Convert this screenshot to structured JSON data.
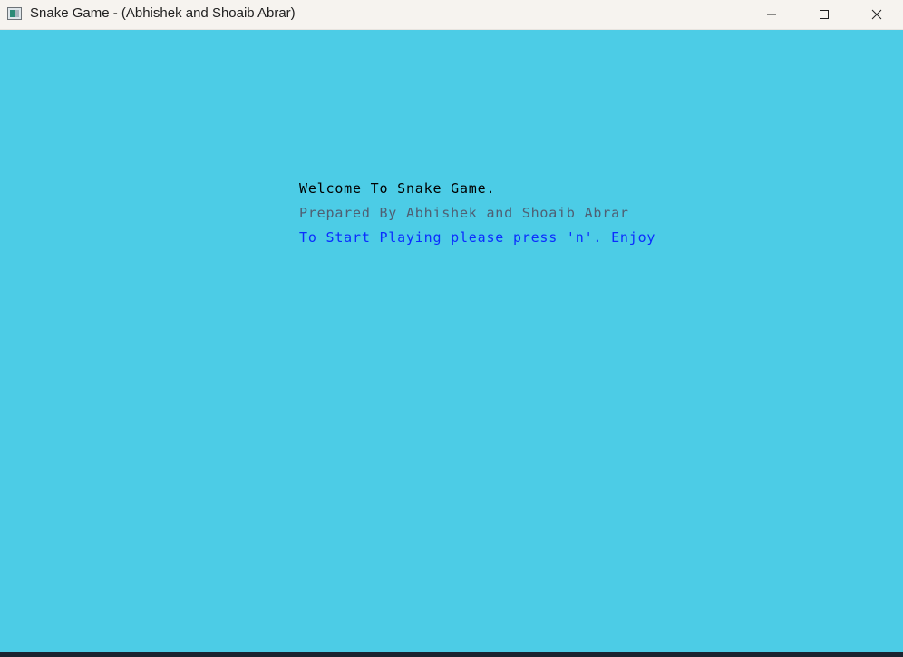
{
  "window": {
    "title": "Snake Game - (Abhishek and Shoaib Abrar)",
    "icon": "app-window-icon",
    "controls": {
      "minimize_icon": "minimize-icon",
      "maximize_icon": "maximize-icon",
      "close_icon": "close-icon"
    }
  },
  "game": {
    "background_color": "#4ccce6",
    "lines": [
      {
        "text": "Welcome To Snake Game.",
        "color": "#000000"
      },
      {
        "text": "Prepared By Abhishek and Shoaib Abrar",
        "color": "#4f5f73"
      },
      {
        "text": "To Start Playing please press 'n'. Enjoy",
        "color": "#0b2dff"
      }
    ]
  }
}
